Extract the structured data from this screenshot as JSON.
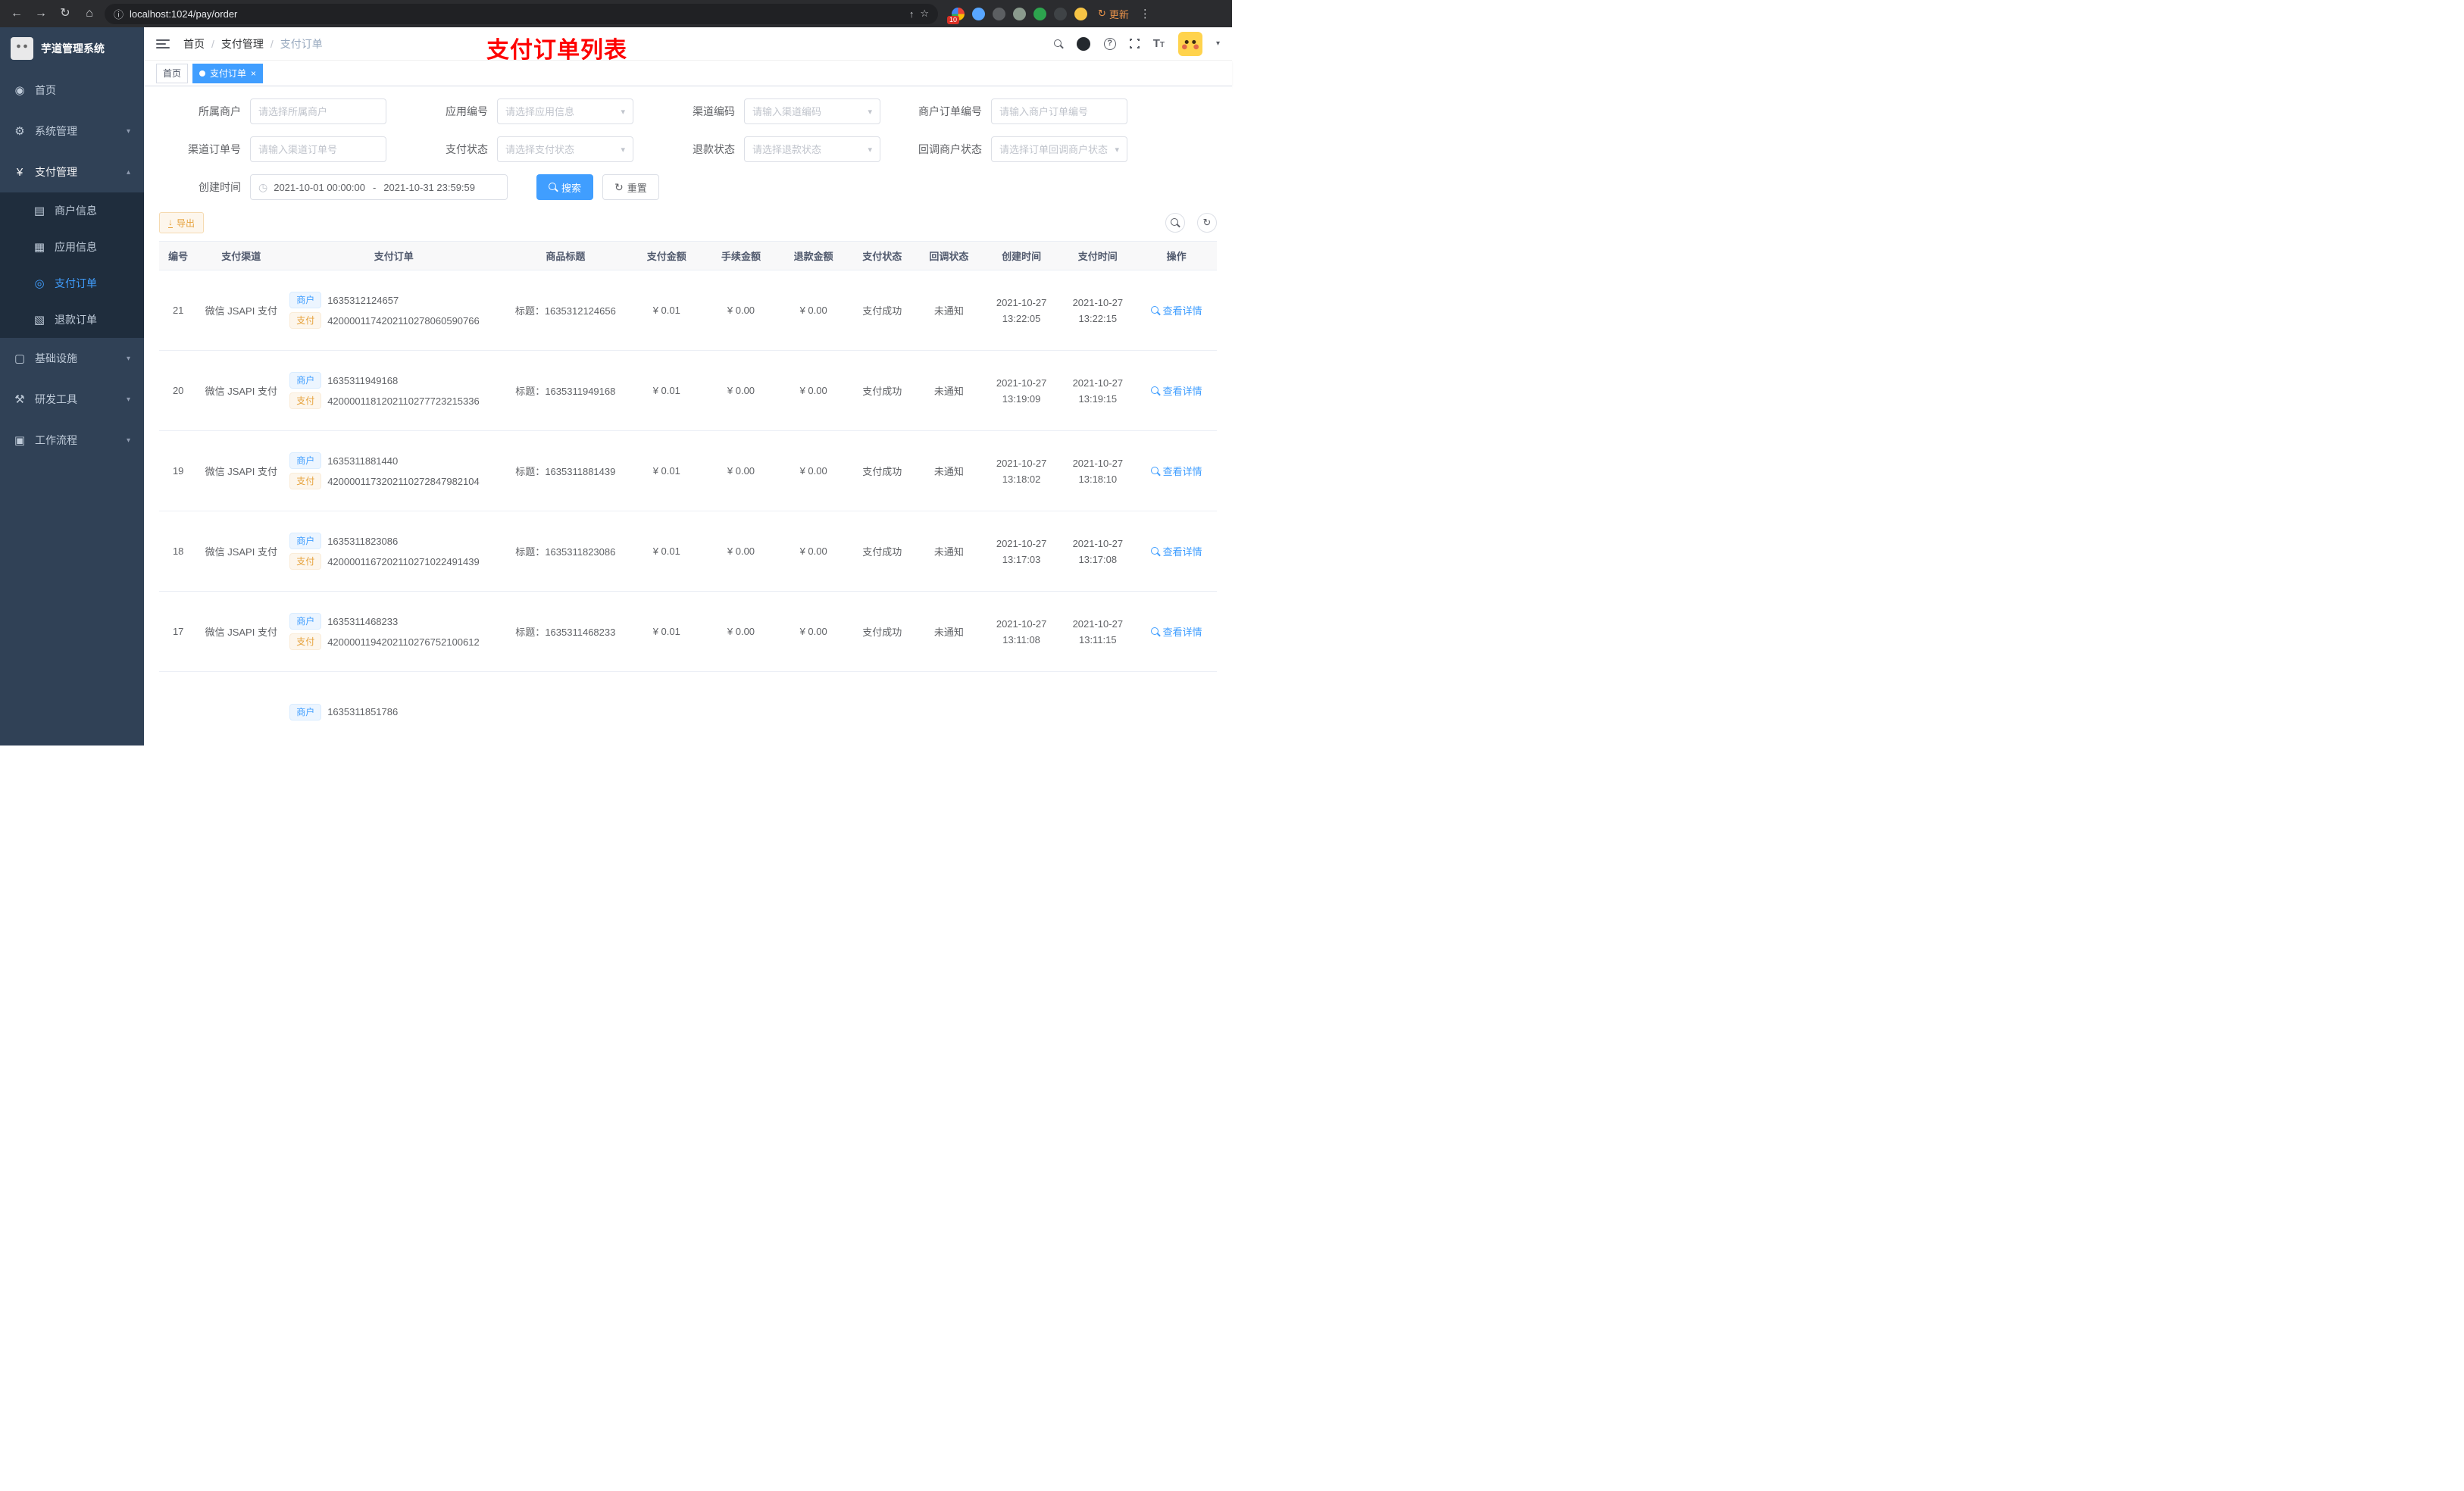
{
  "browser": {
    "url": "localhost:1024/pay/order",
    "update_label": "更新",
    "extension_badge": "10"
  },
  "sidebar": {
    "logo_title": "芋道管理系统",
    "items": [
      {
        "label": "首页"
      },
      {
        "label": "系统管理"
      },
      {
        "label": "支付管理",
        "children": [
          {
            "label": "商户信息"
          },
          {
            "label": "应用信息"
          },
          {
            "label": "支付订单"
          },
          {
            "label": "退款订单"
          }
        ]
      },
      {
        "label": "基础设施"
      },
      {
        "label": "研发工具"
      },
      {
        "label": "工作流程"
      }
    ]
  },
  "header": {
    "breadcrumbs": [
      "首页",
      "支付管理",
      "支付订单"
    ],
    "annotation": "支付订单列表"
  },
  "tabs": [
    {
      "label": "首页"
    },
    {
      "label": "支付订单"
    }
  ],
  "filters": {
    "fields": [
      {
        "label": "所属商户",
        "placeholder": "请选择所属商户"
      },
      {
        "label": "应用编号",
        "placeholder": "请选择应用信息"
      },
      {
        "label": "渠道编码",
        "placeholder": "请输入渠道编码"
      },
      {
        "label": "商户订单编号",
        "placeholder": "请输入商户订单编号"
      },
      {
        "label": "渠道订单号",
        "placeholder": "请输入渠道订单号"
      },
      {
        "label": "支付状态",
        "placeholder": "请选择支付状态"
      },
      {
        "label": "退款状态",
        "placeholder": "请选择退款状态"
      },
      {
        "label": "回调商户状态",
        "placeholder": "请选择订单回调商户状态"
      }
    ],
    "date_label": "创建时间",
    "date_start": "2021-10-01 00:00:00",
    "date_end": "2021-10-31 23:59:59",
    "search_label": "搜索",
    "reset_label": "重置"
  },
  "toolbar": {
    "export_label": "导出"
  },
  "table": {
    "columns": [
      "编号",
      "支付渠道",
      "支付订单",
      "商品标题",
      "支付金额",
      "手续金额",
      "退款金额",
      "支付状态",
      "回调状态",
      "创建时间",
      "支付时间",
      "操作"
    ],
    "tag_merchant": "商户",
    "tag_pay": "支付",
    "title_prefix": "标题：",
    "action_label": "查看详情",
    "rows": [
      {
        "id": "21",
        "channel": "微信 JSAPI 支付",
        "merchant_no": "1635312124657",
        "pay_no": "4200001174202110278060590766",
        "title": "1635312124656",
        "amount": "¥ 0.01",
        "fee": "¥ 0.00",
        "refund": "¥ 0.00",
        "status": "支付成功",
        "notify_status": "未通知",
        "create_date": "2021-10-27",
        "create_time": "13:22:05",
        "pay_date": "2021-10-27",
        "pay_time": "13:22:15"
      },
      {
        "id": "20",
        "channel": "微信 JSAPI 支付",
        "merchant_no": "1635311949168",
        "pay_no": "4200001181202110277723215336",
        "title": "1635311949168",
        "amount": "¥ 0.01",
        "fee": "¥ 0.00",
        "refund": "¥ 0.00",
        "status": "支付成功",
        "notify_status": "未通知",
        "create_date": "2021-10-27",
        "create_time": "13:19:09",
        "pay_date": "2021-10-27",
        "pay_time": "13:19:15"
      },
      {
        "id": "19",
        "channel": "微信 JSAPI 支付",
        "merchant_no": "1635311881440",
        "pay_no": "4200001173202110272847982104",
        "title": "1635311881439",
        "amount": "¥ 0.01",
        "fee": "¥ 0.00",
        "refund": "¥ 0.00",
        "status": "支付成功",
        "notify_status": "未通知",
        "create_date": "2021-10-27",
        "create_time": "13:18:02",
        "pay_date": "2021-10-27",
        "pay_time": "13:18:10"
      },
      {
        "id": "18",
        "channel": "微信 JSAPI 支付",
        "merchant_no": "1635311823086",
        "pay_no": "4200001167202110271022491439",
        "title": "1635311823086",
        "amount": "¥ 0.01",
        "fee": "¥ 0.00",
        "refund": "¥ 0.00",
        "status": "支付成功",
        "notify_status": "未通知",
        "create_date": "2021-10-27",
        "create_time": "13:17:03",
        "pay_date": "2021-10-27",
        "pay_time": "13:17:08"
      },
      {
        "id": "17",
        "channel": "微信 JSAPI 支付",
        "merchant_no": "1635311468233",
        "pay_no": "4200001194202110276752100612",
        "title": "1635311468233",
        "amount": "¥ 0.01",
        "fee": "¥ 0.00",
        "refund": "¥ 0.00",
        "status": "支付成功",
        "notify_status": "未通知",
        "create_date": "2021-10-27",
        "create_time": "13:11:08",
        "pay_date": "2021-10-27",
        "pay_time": "13:11:15"
      }
    ],
    "partial_row": {
      "merchant_no": "1635311851786"
    }
  },
  "colors": {
    "accent": "#409eff",
    "warning": "#e6a23c",
    "annotation_red": "#fe0000",
    "sidebar_bg": "#304156",
    "submenu_bg": "#1f2d3d"
  }
}
